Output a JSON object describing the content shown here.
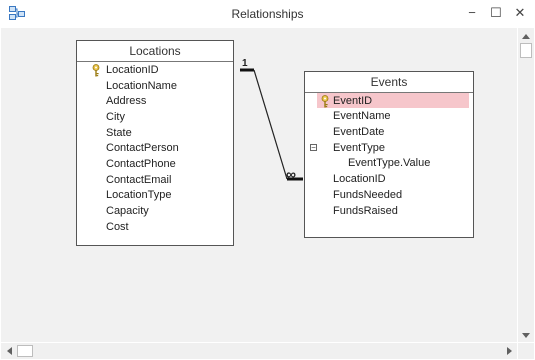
{
  "window": {
    "title": "Relationships"
  },
  "window_controls": {
    "minimize": "−",
    "maximize": "☐",
    "close": "✕"
  },
  "tables": {
    "locations": {
      "name": "Locations",
      "fields": [
        "LocationID",
        "LocationName",
        "Address",
        "City",
        "State",
        "ContactPerson",
        "ContactPhone",
        "ContactEmail",
        "LocationType",
        "Capacity",
        "Cost"
      ],
      "primary_key": "LocationID"
    },
    "events": {
      "name": "Events",
      "fields": [
        "EventID",
        "EventName",
        "EventDate",
        "EventType",
        "EventType.Value",
        "LocationID",
        "FundsNeeded",
        "FundsRaised"
      ],
      "primary_key": "EventID",
      "selected": "EventID",
      "expandable": "EventType"
    }
  },
  "relationship": {
    "one_label": "1",
    "many_label": "∞"
  },
  "colors": {
    "selected_row": "#f6c6cb",
    "canvas": "#f1f1f1"
  }
}
